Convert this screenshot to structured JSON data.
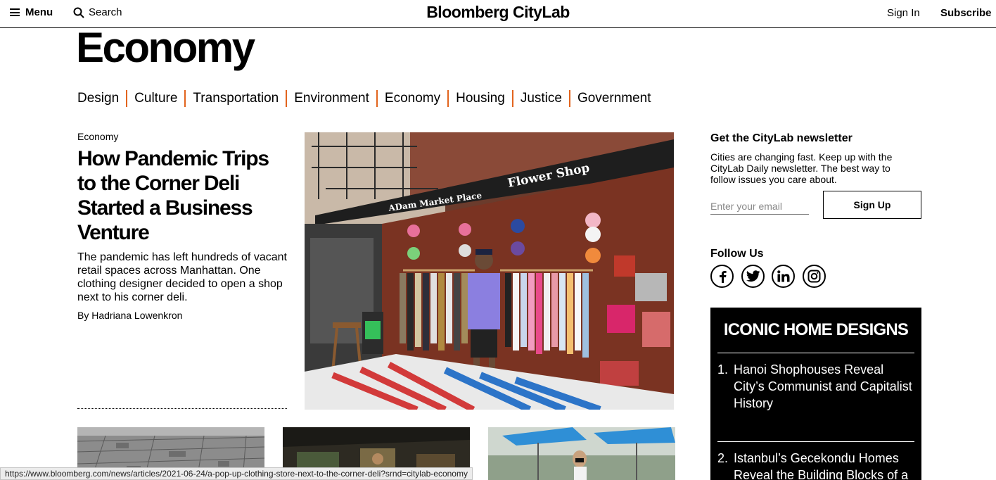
{
  "header": {
    "menu_label": "Menu",
    "search_label": "Search",
    "logo": "Bloomberg CityLab",
    "sign_in": "Sign In",
    "subscribe": "Subscribe"
  },
  "section": {
    "title": "Economy",
    "nav": [
      "Design",
      "Culture",
      "Transportation",
      "Environment",
      "Economy",
      "Housing",
      "Justice",
      "Government"
    ]
  },
  "lead": {
    "kicker": "Economy",
    "headline": "How Pandemic Trips to the Corner Deli Started a Business Venture",
    "dek": "The pandemic has left hundreds of vacant retail spaces across Manhattan. One clothing designer decided to open a shop next to his corner deli.",
    "byline": "By Hadriana Lowenkron",
    "image_signs": [
      "Flower Shop",
      "ADam Market Place"
    ]
  },
  "newsletter": {
    "title": "Get the CityLab newsletter",
    "text": "Cities are changing fast. Keep up with the CityLab Daily newsletter. The best way to follow issues you care about.",
    "placeholder": "Enter your email",
    "button": "Sign Up"
  },
  "follow": {
    "title": "Follow Us",
    "icons": [
      "facebook-icon",
      "twitter-icon",
      "linkedin-icon",
      "instagram-icon"
    ]
  },
  "iconic": {
    "title": "ICONIC HOME DESIGNS",
    "items": [
      {
        "num": "1.",
        "text": "Hanoi Shophouses Reveal City’s Communist and Capitalist History"
      },
      {
        "num": "2.",
        "text": "Istanbul’s Gecekondu Homes Reveal the Building Blocks of a"
      }
    ]
  },
  "status_url": "https://www.bloomberg.com/news/articles/2021-06-24/a-pop-up-clothing-store-next-to-the-corner-deli?srnd=citylab-economy",
  "colors": {
    "accent": "#e2641d",
    "ink": "#000000",
    "panel": "#000000"
  }
}
